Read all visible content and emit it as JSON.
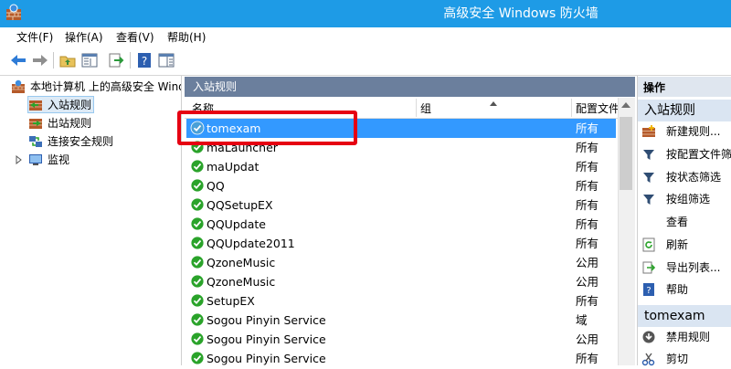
{
  "window": {
    "title": "高级安全 Windows 防火墙"
  },
  "menu": [
    "文件(F)",
    "操作(A)",
    "查看(V)",
    "帮助(H)"
  ],
  "toolbar": [
    "back-icon",
    "forward-icon",
    "up-folder-icon",
    "console-tree-icon",
    "export-icon",
    "help-icon",
    "action-pane-icon"
  ],
  "tree": {
    "root": "本地计算机 上的高级安全 Windows 防火墙",
    "items": [
      "入站规则",
      "出站规则",
      "连接安全规则",
      "监视"
    ]
  },
  "main": {
    "title": "入站规则",
    "columns": {
      "name": "名称",
      "group": "组",
      "profile": "配置文件"
    },
    "rows": [
      {
        "name": "tomexam",
        "profile": "所有",
        "icon": "check-shield-icon",
        "selected": true
      },
      {
        "name": "maLauncher",
        "profile": "所有",
        "icon": "check-shield-icon"
      },
      {
        "name": "maUpdat",
        "profile": "所有",
        "icon": "check-shield-icon"
      },
      {
        "name": "QQ",
        "profile": "所有",
        "icon": "check-shield-icon"
      },
      {
        "name": "QQSetupEX",
        "profile": "所有",
        "icon": "check-shield-icon"
      },
      {
        "name": "QQUpdate",
        "profile": "所有",
        "icon": "check-shield-icon"
      },
      {
        "name": "QQUpdate2011",
        "profile": "所有",
        "icon": "check-shield-icon"
      },
      {
        "name": "QzoneMusic",
        "profile": "公用",
        "icon": "check-shield-icon"
      },
      {
        "name": "QzoneMusic",
        "profile": "公用",
        "icon": "check-shield-icon"
      },
      {
        "name": "SetupEX",
        "profile": "所有",
        "icon": "check-shield-icon"
      },
      {
        "name": "Sogou Pinyin Service",
        "profile": "域",
        "icon": "check-shield-icon"
      },
      {
        "name": "Sogou Pinyin Service",
        "profile": "公用",
        "icon": "check-shield-icon"
      },
      {
        "name": "Sogou Pinyin Service",
        "profile": "所有",
        "icon": "check-shield-icon"
      }
    ]
  },
  "actions": {
    "header": "操作",
    "group1_title": "入站规则",
    "group1": [
      "新建规则...",
      "按配置文件筛选",
      "按状态筛选",
      "按组筛选",
      "查看",
      "刷新",
      "导出列表...",
      "帮助"
    ],
    "group2_title": "tomexam",
    "group2": [
      "禁用规则",
      "剪切"
    ]
  },
  "colors": {
    "titlebar": "#1e9be6",
    "panel_header": "#6b7f9d",
    "selection": "#3399ff",
    "highlight_box": "#e60012",
    "enabled_green": "#2aa32a"
  }
}
